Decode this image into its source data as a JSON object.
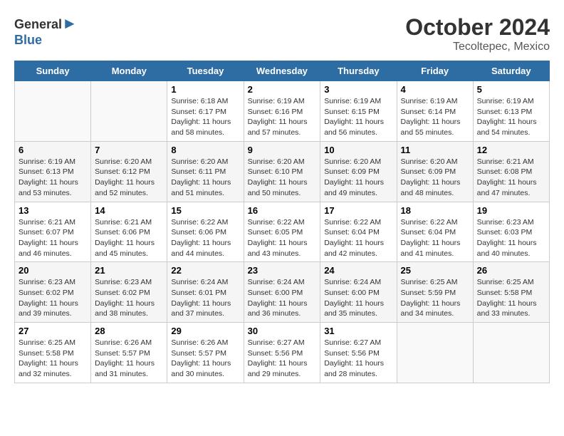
{
  "header": {
    "logo_general": "General",
    "logo_blue": "Blue",
    "month_year": "October 2024",
    "location": "Tecoltepec, Mexico"
  },
  "days_of_week": [
    "Sunday",
    "Monday",
    "Tuesday",
    "Wednesday",
    "Thursday",
    "Friday",
    "Saturday"
  ],
  "weeks": [
    [
      {
        "day": "",
        "empty": true
      },
      {
        "day": "",
        "empty": true
      },
      {
        "day": "1",
        "sunrise": "Sunrise: 6:18 AM",
        "sunset": "Sunset: 6:17 PM",
        "daylight": "Daylight: 11 hours and 58 minutes."
      },
      {
        "day": "2",
        "sunrise": "Sunrise: 6:19 AM",
        "sunset": "Sunset: 6:16 PM",
        "daylight": "Daylight: 11 hours and 57 minutes."
      },
      {
        "day": "3",
        "sunrise": "Sunrise: 6:19 AM",
        "sunset": "Sunset: 6:15 PM",
        "daylight": "Daylight: 11 hours and 56 minutes."
      },
      {
        "day": "4",
        "sunrise": "Sunrise: 6:19 AM",
        "sunset": "Sunset: 6:14 PM",
        "daylight": "Daylight: 11 hours and 55 minutes."
      },
      {
        "day": "5",
        "sunrise": "Sunrise: 6:19 AM",
        "sunset": "Sunset: 6:13 PM",
        "daylight": "Daylight: 11 hours and 54 minutes."
      }
    ],
    [
      {
        "day": "6",
        "sunrise": "Sunrise: 6:19 AM",
        "sunset": "Sunset: 6:13 PM",
        "daylight": "Daylight: 11 hours and 53 minutes."
      },
      {
        "day": "7",
        "sunrise": "Sunrise: 6:20 AM",
        "sunset": "Sunset: 6:12 PM",
        "daylight": "Daylight: 11 hours and 52 minutes."
      },
      {
        "day": "8",
        "sunrise": "Sunrise: 6:20 AM",
        "sunset": "Sunset: 6:11 PM",
        "daylight": "Daylight: 11 hours and 51 minutes."
      },
      {
        "day": "9",
        "sunrise": "Sunrise: 6:20 AM",
        "sunset": "Sunset: 6:10 PM",
        "daylight": "Daylight: 11 hours and 50 minutes."
      },
      {
        "day": "10",
        "sunrise": "Sunrise: 6:20 AM",
        "sunset": "Sunset: 6:09 PM",
        "daylight": "Daylight: 11 hours and 49 minutes."
      },
      {
        "day": "11",
        "sunrise": "Sunrise: 6:20 AM",
        "sunset": "Sunset: 6:09 PM",
        "daylight": "Daylight: 11 hours and 48 minutes."
      },
      {
        "day": "12",
        "sunrise": "Sunrise: 6:21 AM",
        "sunset": "Sunset: 6:08 PM",
        "daylight": "Daylight: 11 hours and 47 minutes."
      }
    ],
    [
      {
        "day": "13",
        "sunrise": "Sunrise: 6:21 AM",
        "sunset": "Sunset: 6:07 PM",
        "daylight": "Daylight: 11 hours and 46 minutes."
      },
      {
        "day": "14",
        "sunrise": "Sunrise: 6:21 AM",
        "sunset": "Sunset: 6:06 PM",
        "daylight": "Daylight: 11 hours and 45 minutes."
      },
      {
        "day": "15",
        "sunrise": "Sunrise: 6:22 AM",
        "sunset": "Sunset: 6:06 PM",
        "daylight": "Daylight: 11 hours and 44 minutes."
      },
      {
        "day": "16",
        "sunrise": "Sunrise: 6:22 AM",
        "sunset": "Sunset: 6:05 PM",
        "daylight": "Daylight: 11 hours and 43 minutes."
      },
      {
        "day": "17",
        "sunrise": "Sunrise: 6:22 AM",
        "sunset": "Sunset: 6:04 PM",
        "daylight": "Daylight: 11 hours and 42 minutes."
      },
      {
        "day": "18",
        "sunrise": "Sunrise: 6:22 AM",
        "sunset": "Sunset: 6:04 PM",
        "daylight": "Daylight: 11 hours and 41 minutes."
      },
      {
        "day": "19",
        "sunrise": "Sunrise: 6:23 AM",
        "sunset": "Sunset: 6:03 PM",
        "daylight": "Daylight: 11 hours and 40 minutes."
      }
    ],
    [
      {
        "day": "20",
        "sunrise": "Sunrise: 6:23 AM",
        "sunset": "Sunset: 6:02 PM",
        "daylight": "Daylight: 11 hours and 39 minutes."
      },
      {
        "day": "21",
        "sunrise": "Sunrise: 6:23 AM",
        "sunset": "Sunset: 6:02 PM",
        "daylight": "Daylight: 11 hours and 38 minutes."
      },
      {
        "day": "22",
        "sunrise": "Sunrise: 6:24 AM",
        "sunset": "Sunset: 6:01 PM",
        "daylight": "Daylight: 11 hours and 37 minutes."
      },
      {
        "day": "23",
        "sunrise": "Sunrise: 6:24 AM",
        "sunset": "Sunset: 6:00 PM",
        "daylight": "Daylight: 11 hours and 36 minutes."
      },
      {
        "day": "24",
        "sunrise": "Sunrise: 6:24 AM",
        "sunset": "Sunset: 6:00 PM",
        "daylight": "Daylight: 11 hours and 35 minutes."
      },
      {
        "day": "25",
        "sunrise": "Sunrise: 6:25 AM",
        "sunset": "Sunset: 5:59 PM",
        "daylight": "Daylight: 11 hours and 34 minutes."
      },
      {
        "day": "26",
        "sunrise": "Sunrise: 6:25 AM",
        "sunset": "Sunset: 5:58 PM",
        "daylight": "Daylight: 11 hours and 33 minutes."
      }
    ],
    [
      {
        "day": "27",
        "sunrise": "Sunrise: 6:25 AM",
        "sunset": "Sunset: 5:58 PM",
        "daylight": "Daylight: 11 hours and 32 minutes."
      },
      {
        "day": "28",
        "sunrise": "Sunrise: 6:26 AM",
        "sunset": "Sunset: 5:57 PM",
        "daylight": "Daylight: 11 hours and 31 minutes."
      },
      {
        "day": "29",
        "sunrise": "Sunrise: 6:26 AM",
        "sunset": "Sunset: 5:57 PM",
        "daylight": "Daylight: 11 hours and 30 minutes."
      },
      {
        "day": "30",
        "sunrise": "Sunrise: 6:27 AM",
        "sunset": "Sunset: 5:56 PM",
        "daylight": "Daylight: 11 hours and 29 minutes."
      },
      {
        "day": "31",
        "sunrise": "Sunrise: 6:27 AM",
        "sunset": "Sunset: 5:56 PM",
        "daylight": "Daylight: 11 hours and 28 minutes."
      },
      {
        "day": "",
        "empty": true
      },
      {
        "day": "",
        "empty": true
      }
    ]
  ]
}
